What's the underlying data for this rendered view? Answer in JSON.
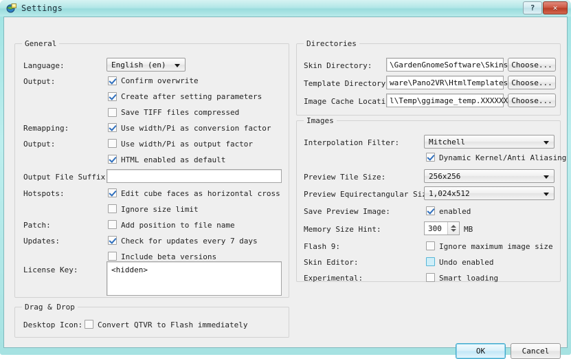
{
  "window": {
    "title": "Settings",
    "icon": "app-icon",
    "help_label": "?",
    "close_label": "✕",
    "frame_color": "#9fe3e3",
    "accent_color": "#3fa8cc"
  },
  "general": {
    "legend": "General",
    "language_label": "Language:",
    "language_value": "English (en)",
    "output_label": "Output:",
    "confirm_overwrite": "Confirm overwrite",
    "create_after_setting": "Create after setting parameters",
    "save_tiff": "Save TIFF files compressed",
    "remapping_label": "Remapping:",
    "use_width_pi_conversion": "Use width/Pi as conversion factor",
    "output_label2": "Output:",
    "use_width_pi_output": "Use width/Pi as output factor",
    "html_enabled": "HTML enabled as default",
    "suffix_label": "Output File Suffix:",
    "suffix_value": "",
    "hotspots_label": "Hotspots:",
    "edit_cube_faces": "Edit cube faces as horizontal cross",
    "ignore_size_limit": "Ignore size limit",
    "patch_label": "Patch:",
    "add_position": "Add position to file name",
    "updates_label": "Updates:",
    "check_updates": "Check for updates every 7 days",
    "include_beta": "Include beta versions",
    "license_label": "License Key:",
    "license_value": "<hidden>"
  },
  "dragdrop": {
    "legend": "Drag & Drop",
    "desktop_icon_label": "Desktop Icon:",
    "convert_qtvr": "Convert QTVR to Flash immediately"
  },
  "directories": {
    "legend": "Directories",
    "choose_label": "Choose...",
    "rows": [
      {
        "label": "Skin Directory:",
        "value": "\\GardenGnomeSoftware\\Skins"
      },
      {
        "label": "Template Directory:",
        "value": "ware\\Pano2VR\\HtmlTemplates"
      },
      {
        "label": "Image Cache Location:",
        "value": "l\\Temp\\ggimage_temp.XXXXXX"
      }
    ]
  },
  "images": {
    "legend": "Images",
    "interpolation_label": "Interpolation Filter:",
    "interpolation_value": "Mitchell",
    "dynamic_kernel": "Dynamic Kernel/Anti Aliasing",
    "tile_size_label": "Preview Tile Size:",
    "tile_size_value": "256x256",
    "equirect_label": "Preview Equirectangular Size:",
    "equirect_value": "1,024x512",
    "save_preview_label": "Save Preview Image:",
    "save_preview_text": "enabled",
    "memory_label": "Memory Size Hint:",
    "memory_value": "300",
    "memory_unit": "MB",
    "flash_label": "Flash 9:",
    "ignore_max_image": "Ignore maximum image size",
    "skin_editor_label": "Skin Editor:",
    "undo_enabled": "Undo enabled",
    "experimental_label": "Experimental:",
    "smart_loading": "Smart loading"
  },
  "footer": {
    "ok_label": "OK",
    "cancel_label": "Cancel"
  }
}
